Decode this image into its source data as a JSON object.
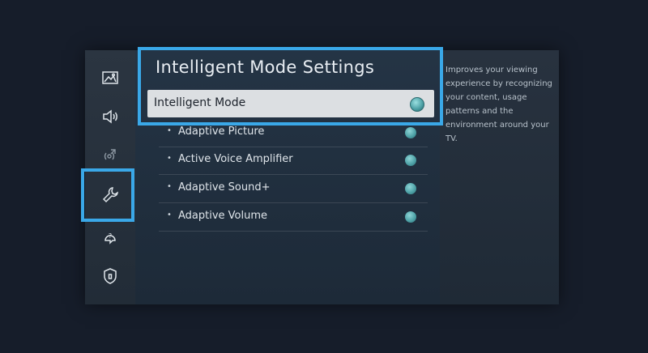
{
  "title": "Intelligent Mode Settings",
  "selected": {
    "label": "Intelligent Mode",
    "on": true
  },
  "items": [
    {
      "label": "Adaptive Picture",
      "on": true
    },
    {
      "label": "Active Voice Amplifier",
      "on": true
    },
    {
      "label": "Adaptive Sound+",
      "on": true
    },
    {
      "label": "Adaptive Volume",
      "on": true
    }
  ],
  "description": "Improves your viewing experience by recognizing your content, usage patterns and the environment around your TV.",
  "sidebar": [
    {
      "icon": "picture-icon"
    },
    {
      "icon": "sound-icon"
    },
    {
      "icon": "broadcast-icon"
    },
    {
      "icon": "wrench-icon",
      "active": true
    },
    {
      "icon": "support-icon"
    },
    {
      "icon": "shield-icon"
    }
  ],
  "colors": {
    "accent": "#3aa8e8",
    "toggle": "#4fa3a8"
  }
}
